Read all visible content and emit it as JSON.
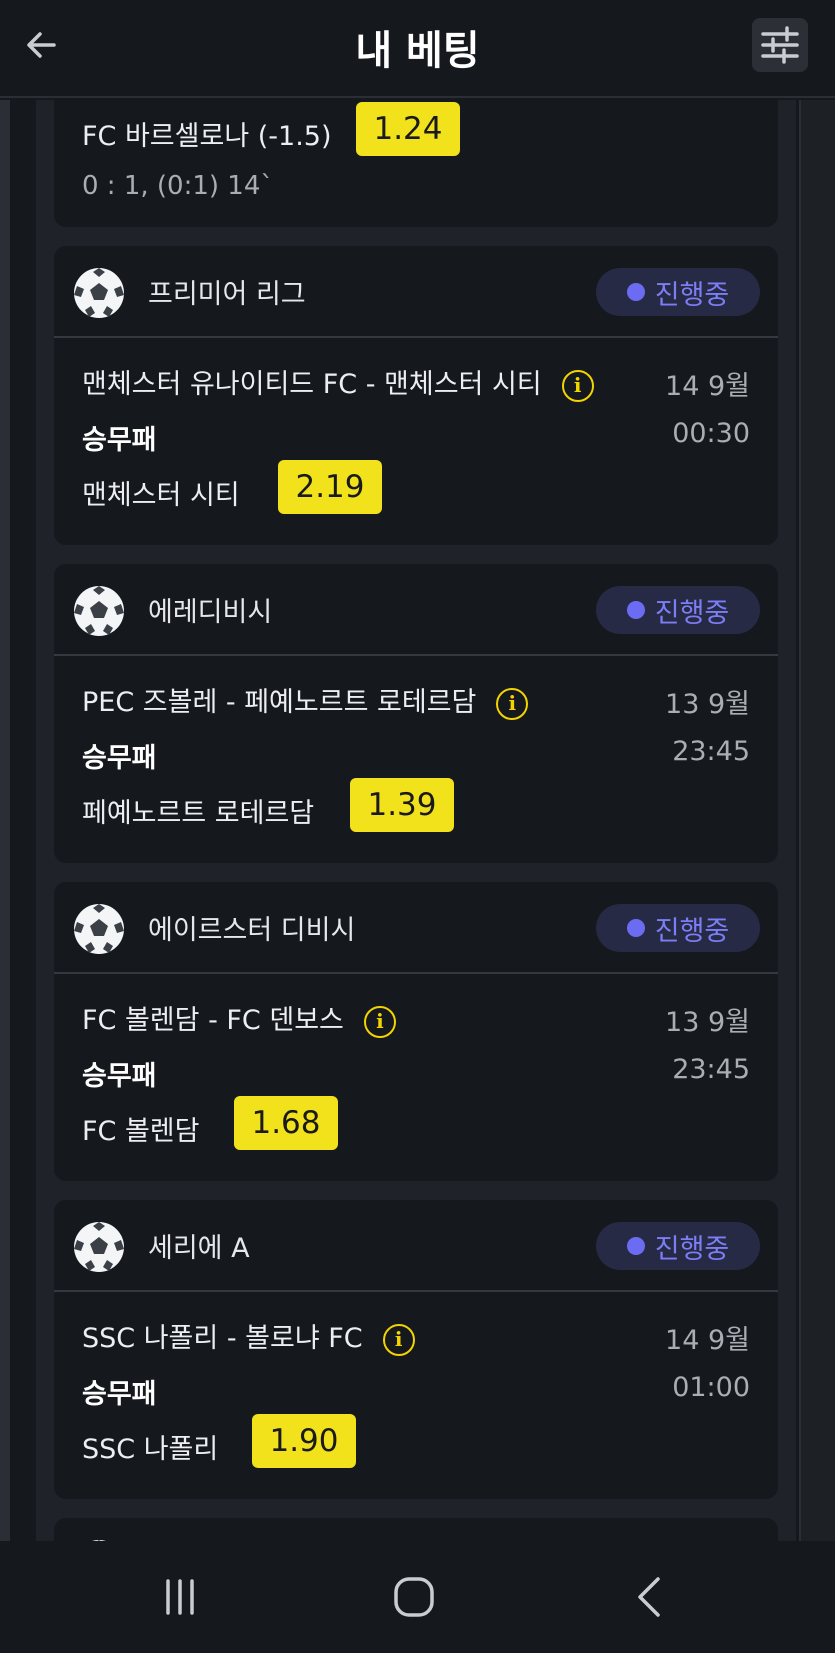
{
  "header": {
    "title": "내 베팅",
    "back_icon": "arrow-left-icon",
    "filter_icon": "sliders-icon"
  },
  "partial_bet": {
    "pick": "FC 바르셀로나 (-1.5)",
    "odds": "1.24",
    "score": "0 : 1, (0:1) 14`"
  },
  "bets": [
    {
      "league": "프리미어 리그",
      "status": "진행중",
      "match": "맨체스터 유나이티드 FC - 맨체스터 시티",
      "date": "14 9월",
      "market": "승무패",
      "time": "00:30",
      "pick": "맨체스터 시티",
      "odds": "2.19"
    },
    {
      "league": "에레디비시",
      "status": "진행중",
      "match": "PEC 즈볼레 - 페예노르트 로테르담",
      "date": "13 9월",
      "market": "승무패",
      "time": "23:45",
      "pick": "페예노르트 로테르담",
      "odds": "1.39"
    },
    {
      "league": "에이르스터 디비시",
      "status": "진행중",
      "match": "FC 볼렌담 - FC 덴보스",
      "date": "13 9월",
      "market": "승무패",
      "time": "23:45",
      "pick": "FC 볼렌담",
      "odds": "1.68"
    },
    {
      "league": "세리에 A",
      "status": "진행중",
      "match": "SSC 나폴리 - 볼로냐 FC",
      "date": "14 9월",
      "market": "승무패",
      "time": "01:00",
      "pick": "SSC 나폴리",
      "odds": "1.90"
    }
  ],
  "info_icon": {
    "symbol": "i",
    "name": "info-icon"
  },
  "colors": {
    "background": "#15181d",
    "card": "#15181d",
    "odds": "#f2e21c",
    "status": "#7c7ef5",
    "info": "#f2d400"
  },
  "navbar": {
    "icons": [
      "recent-apps-icon",
      "home-icon",
      "back-icon"
    ]
  }
}
